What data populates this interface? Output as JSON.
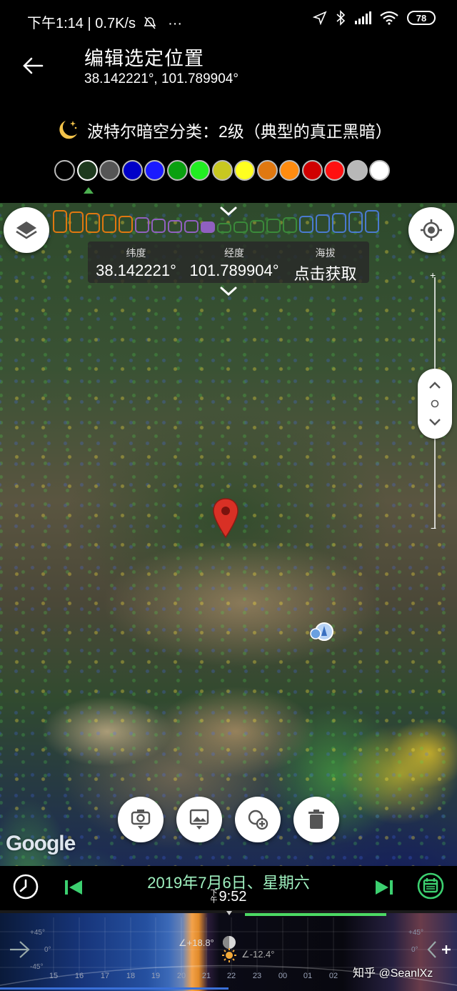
{
  "status_bar": {
    "time": "下午1:14",
    "network_speed": "0.7K/s",
    "more": "···",
    "battery": "78"
  },
  "header": {
    "title": "编辑选定位置",
    "coordinates": "38.142221°, 101.789904°"
  },
  "bortle": {
    "label": "波特尔暗空分类：2级（典型的真正黑暗）",
    "selected_index": 1,
    "swatches": [
      "#000000",
      "#1e3a1e",
      "#555555",
      "#0000c8",
      "#1a1aff",
      "#0aa010",
      "#22ee22",
      "#c8c820",
      "#ffff20",
      "#e07810",
      "#ff8c10",
      "#d00000",
      "#ff1010",
      "#b8b8b8",
      "#ffffff"
    ]
  },
  "map": {
    "coords_panel": {
      "lat_label": "纬度",
      "lat_value": "38.142221°",
      "lon_label": "经度",
      "lon_value": "101.789904°",
      "alt_label": "海拔",
      "alt_value": "点击获取"
    },
    "attribution": "Google",
    "scale_colors": [
      "#e07810",
      "#e07810",
      "#e07810",
      "#e07810",
      "#e07810",
      "#9060c0",
      "#9060c0",
      "#9060c0",
      "#9060c0",
      "#9060c0",
      "#3a8a3a",
      "#3a8a3a",
      "#3a8a3a",
      "#3a8a3a",
      "#3a8a3a",
      "#4a7ad0",
      "#4a7ad0",
      "#4a7ad0",
      "#4a7ad0",
      "#4a7ad0"
    ],
    "scale_selected_index": 9
  },
  "date_bar": {
    "date": "2019年7月6日、星期六",
    "ampm": "下午",
    "time": "9:52"
  },
  "timeline": {
    "hours": [
      "15",
      "16",
      "17",
      "18",
      "19",
      "20",
      "21",
      "22",
      "23",
      "00",
      "01",
      "02"
    ],
    "deg_labels": [
      "+45°",
      "0°",
      "-45°"
    ],
    "moon_alt": "∠+18.8°",
    "sun_alt": "∠-12.4°"
  },
  "watermark": "知乎 @SeanlXz",
  "colors": {
    "accent_green": "#4cd964",
    "date_text": "#9ff0bf",
    "pin_red": "#d93025"
  }
}
